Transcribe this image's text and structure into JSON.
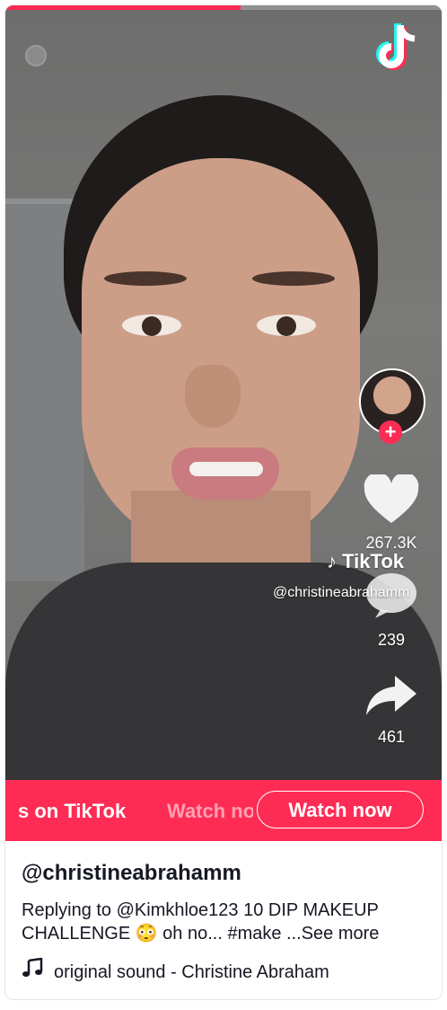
{
  "video": {
    "progress": 0.54,
    "likes": "267.3K",
    "comments": "239",
    "shares": "461",
    "watermark_logo": "TikTok",
    "watermark_user": "@christineabrahamm"
  },
  "banner": {
    "marquee_text": "s on TikTok",
    "marquee_faded": "Watch now",
    "watch_button": "Watch now"
  },
  "post": {
    "username": "@christineabrahamm",
    "caption_text": "Replying to @Kimkhloe123 10 DIP MAKEUP CHALLENGE 😳 oh no... #make",
    "see_more": "...See more",
    "sound": "original sound - Christine Abraham"
  },
  "colors": {
    "accent": "#fe2c55",
    "text": "#161823"
  },
  "icons": {
    "brand": "tiktok-logo-icon",
    "like": "heart-icon",
    "comment": "comment-bubble-icon",
    "share": "share-arrow-icon",
    "sound": "music-note-icon",
    "follow": "plus-icon"
  }
}
